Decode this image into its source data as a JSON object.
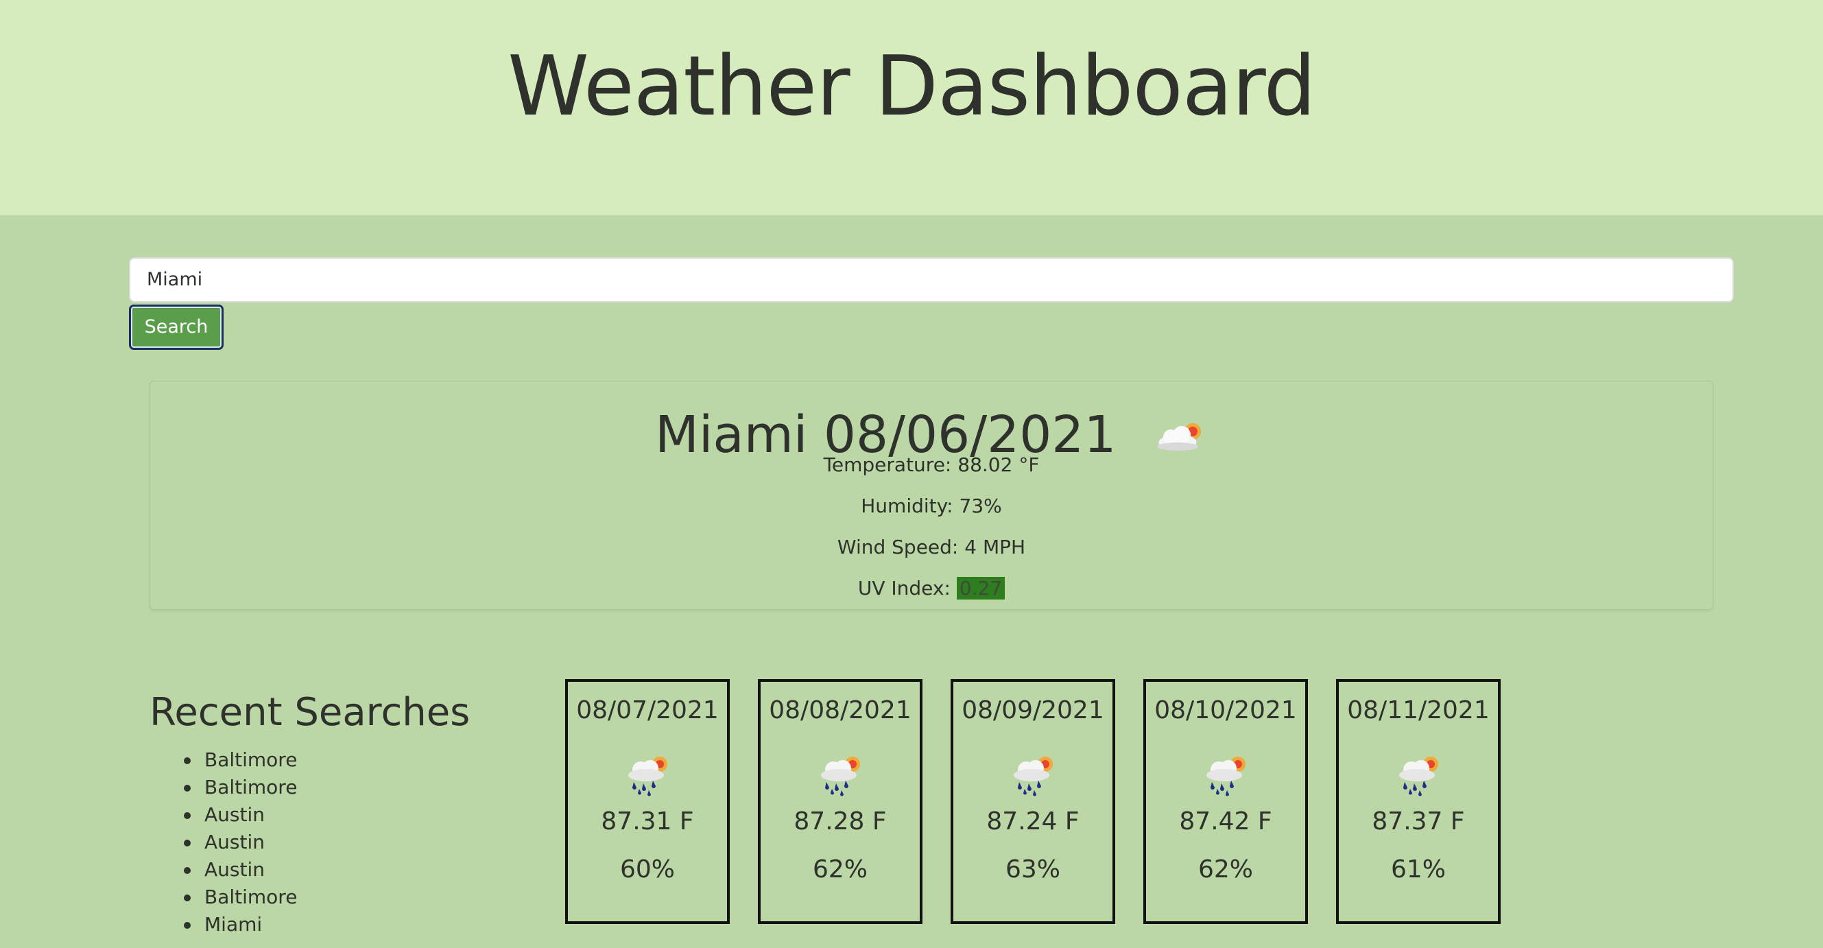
{
  "header": {
    "title": "Weather Dashboard"
  },
  "search": {
    "value": "Miami",
    "button_label": "Search"
  },
  "current": {
    "title": "Miami 08/06/2021",
    "icon": "partly-cloudy-icon",
    "temperature": "Temperature: 88.02 °F",
    "humidity": "Humidity: 73%",
    "wind": "Wind Speed: 4 MPH",
    "uv_label": "UV Index: ",
    "uv_value": "0.27",
    "uv_color": "#2e7d1e"
  },
  "recent": {
    "title": "Recent Searches",
    "items": [
      "Baltimore",
      "Baltimore",
      "Austin",
      "Austin",
      "Austin",
      "Baltimore",
      "Miami"
    ]
  },
  "forecast": [
    {
      "date": "08/07/2021",
      "icon": "rain-sun-icon",
      "temp": "87.31 F",
      "humidity": "60%"
    },
    {
      "date": "08/08/2021",
      "icon": "rain-sun-icon",
      "temp": "87.28 F",
      "humidity": "62%"
    },
    {
      "date": "08/09/2021",
      "icon": "rain-sun-icon",
      "temp": "87.24 F",
      "humidity": "63%"
    },
    {
      "date": "08/10/2021",
      "icon": "rain-sun-icon",
      "temp": "87.42 F",
      "humidity": "62%"
    },
    {
      "date": "08/11/2021",
      "icon": "rain-sun-icon",
      "temp": "87.37 F",
      "humidity": "61%"
    }
  ],
  "colors": {
    "header_bg": "#d6ecbd",
    "page_bg": "#bad7a5",
    "button_bg": "#5a9e4c"
  }
}
